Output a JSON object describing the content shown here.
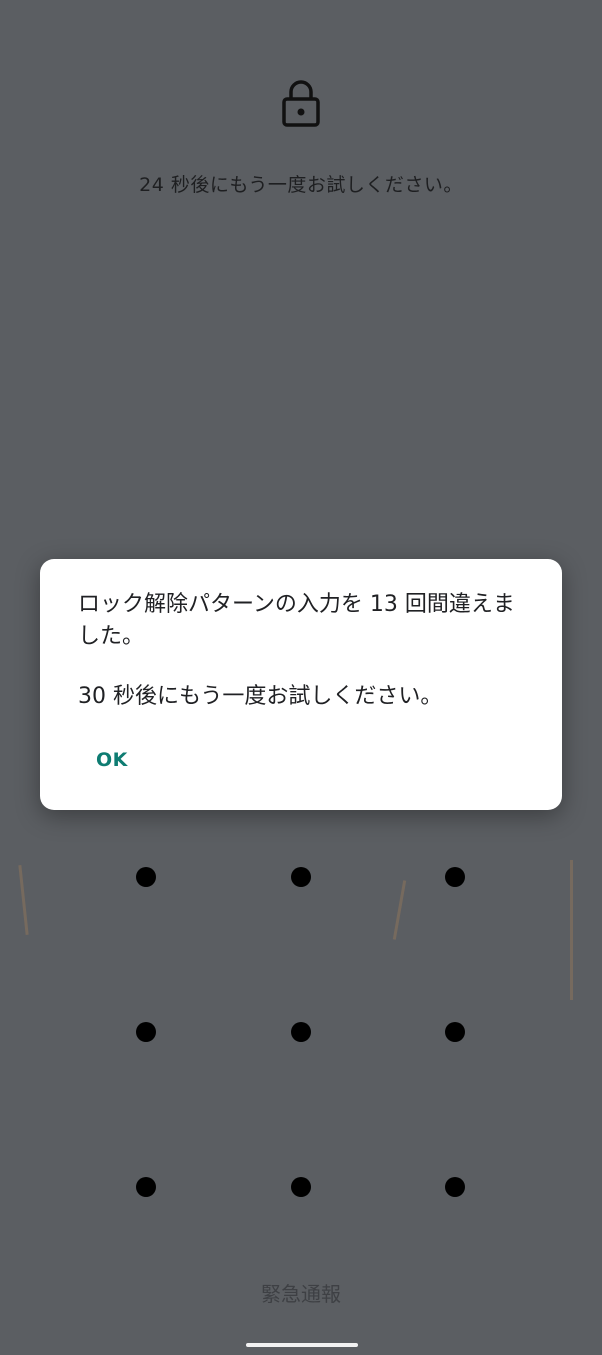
{
  "lockscreen": {
    "lock_icon": "lock-icon",
    "countdown_text": "24 秒後にもう一度お試しください。",
    "pattern_dots": [
      {
        "row": 1,
        "col": 1
      },
      {
        "row": 1,
        "col": 2
      },
      {
        "row": 1,
        "col": 3
      },
      {
        "row": 2,
        "col": 1
      },
      {
        "row": 2,
        "col": 2
      },
      {
        "row": 2,
        "col": 3
      },
      {
        "row": 3,
        "col": 1
      },
      {
        "row": 3,
        "col": 2
      },
      {
        "row": 3,
        "col": 3
      }
    ],
    "emergency_label": "緊急通報"
  },
  "dialog": {
    "message": "ロック解除パターンの入力を 13 回間違えました。",
    "retry_text": "30 秒後にもう一度お試しください。",
    "ok_label": "OK"
  },
  "colors": {
    "accent": "#0e7c72",
    "background": "#5b5e62",
    "dialog_background": "#ffffff"
  }
}
